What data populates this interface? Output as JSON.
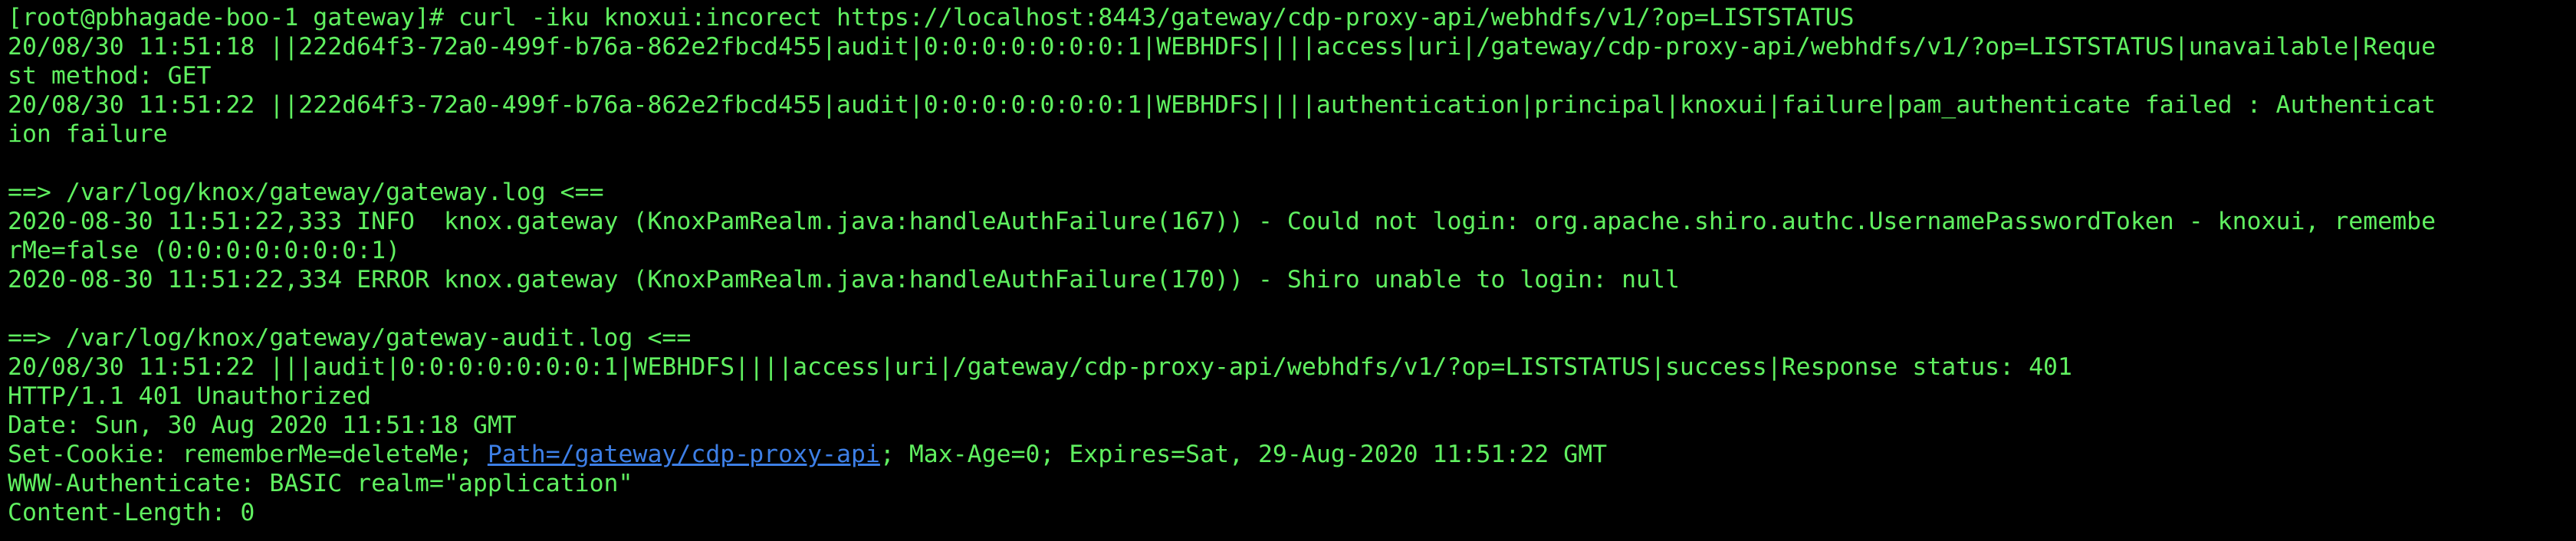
{
  "colors": {
    "background": "#000000",
    "text": "#60f060",
    "link": "#3d7fe6"
  },
  "terminal": {
    "lines": [
      "[root@pbhagade-boo-1 gateway]# curl -iku knoxui:incorect https://localhost:8443/gateway/cdp-proxy-api/webhdfs/v1/?op=LISTSTATUS",
      "20/08/30 11:51:18 ||222d64f3-72a0-499f-b76a-862e2fbcd455|audit|0:0:0:0:0:0:0:1|WEBHDFS||||access|uri|/gateway/cdp-proxy-api/webhdfs/v1/?op=LISTSTATUS|unavailable|Reque",
      "st method: GET",
      "20/08/30 11:51:22 ||222d64f3-72a0-499f-b76a-862e2fbcd455|audit|0:0:0:0:0:0:0:1|WEBHDFS||||authentication|principal|knoxui|failure|pam_authenticate failed : Authenticat",
      "ion failure",
      "",
      "==> /var/log/knox/gateway/gateway.log <==",
      "2020-08-30 11:51:22,333 INFO  knox.gateway (KnoxPamRealm.java:handleAuthFailure(167)) - Could not login: org.apache.shiro.authc.UsernamePasswordToken - knoxui, remembe",
      "rMe=false (0:0:0:0:0:0:0:1)",
      "2020-08-30 11:51:22,334 ERROR knox.gateway (KnoxPamRealm.java:handleAuthFailure(170)) - Shiro unable to login: null",
      "",
      "==> /var/log/knox/gateway/gateway-audit.log <==",
      "20/08/30 11:51:22 |||audit|0:0:0:0:0:0:0:1|WEBHDFS||||access|uri|/gateway/cdp-proxy-api/webhdfs/v1/?op=LISTSTATUS|success|Response status: 401",
      "HTTP/1.1 401 Unauthorized",
      "Date: Sun, 30 Aug 2020 11:51:18 GMT"
    ],
    "cookie_line": {
      "prefix": "Set-Cookie: rememberMe=deleteMe; ",
      "link": "Path=/gateway/cdp-proxy-api",
      "suffix": "; Max-Age=0; Expires=Sat, 29-Aug-2020 11:51:22 GMT"
    },
    "final_lines": [
      "WWW-Authenticate: BASIC realm=\"application\"",
      "Content-Length: 0"
    ]
  }
}
